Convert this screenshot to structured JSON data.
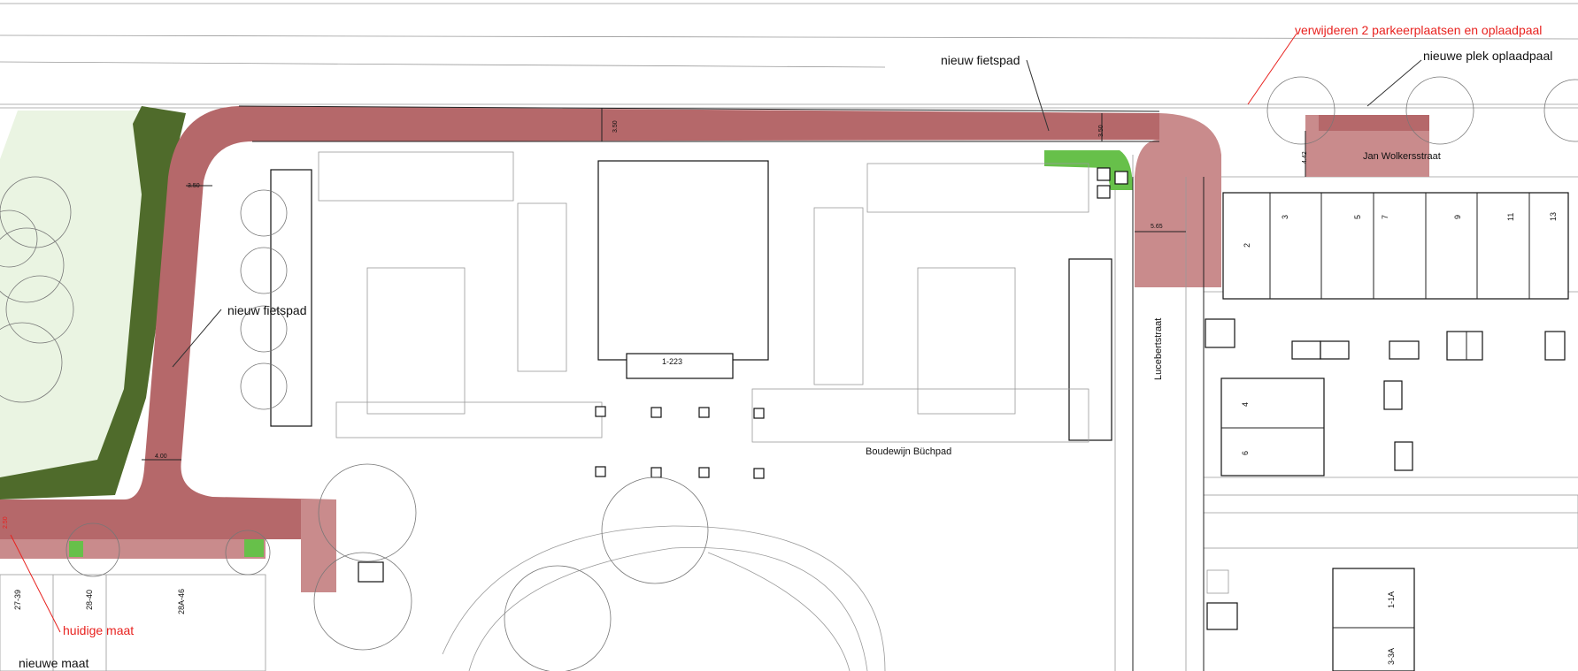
{
  "annotations": {
    "remove_parking": "verwijderen 2 parkeerplaatsen en oplaadpaal",
    "new_charger_spot": "nieuwe plek oplaadpaal",
    "new_bikepath_top": "nieuw fietspad",
    "new_bikepath_left": "nieuw fietspad",
    "current_size": "huidige maat",
    "new_size": "nieuwe maat"
  },
  "streets": {
    "jan_wolkers": "Jan Wolkersstraat",
    "lucebert": "Lucebertstraat",
    "boudewijn": "Boudewijn Büchpad"
  },
  "dimensions": {
    "d_350_a": "3.50",
    "d_350_b": "3.50",
    "d_350_left": "3.50",
    "d_400": "4.00",
    "d_565": "5.65",
    "d_442": "4.42",
    "d_250": "2.50"
  },
  "house_numbers": {
    "main_block": "1-223",
    "h2": "2",
    "h3": "3",
    "h5": "5",
    "h7": "7",
    "h9": "9",
    "h11": "11",
    "h13": "13",
    "h4": "4",
    "h6": "6",
    "n27_39": "27-39",
    "n28_40": "28-40",
    "n28a_46": "28A-46",
    "n1_1a": "1-1A",
    "n3_3a": "3-3A"
  },
  "colors": {
    "bikepath": "#b5686a",
    "bikepath_light": "#c98b8c",
    "green_area": "#67c04a",
    "hedge": "#4f6b2b",
    "annotation_red": "#e8221f"
  }
}
